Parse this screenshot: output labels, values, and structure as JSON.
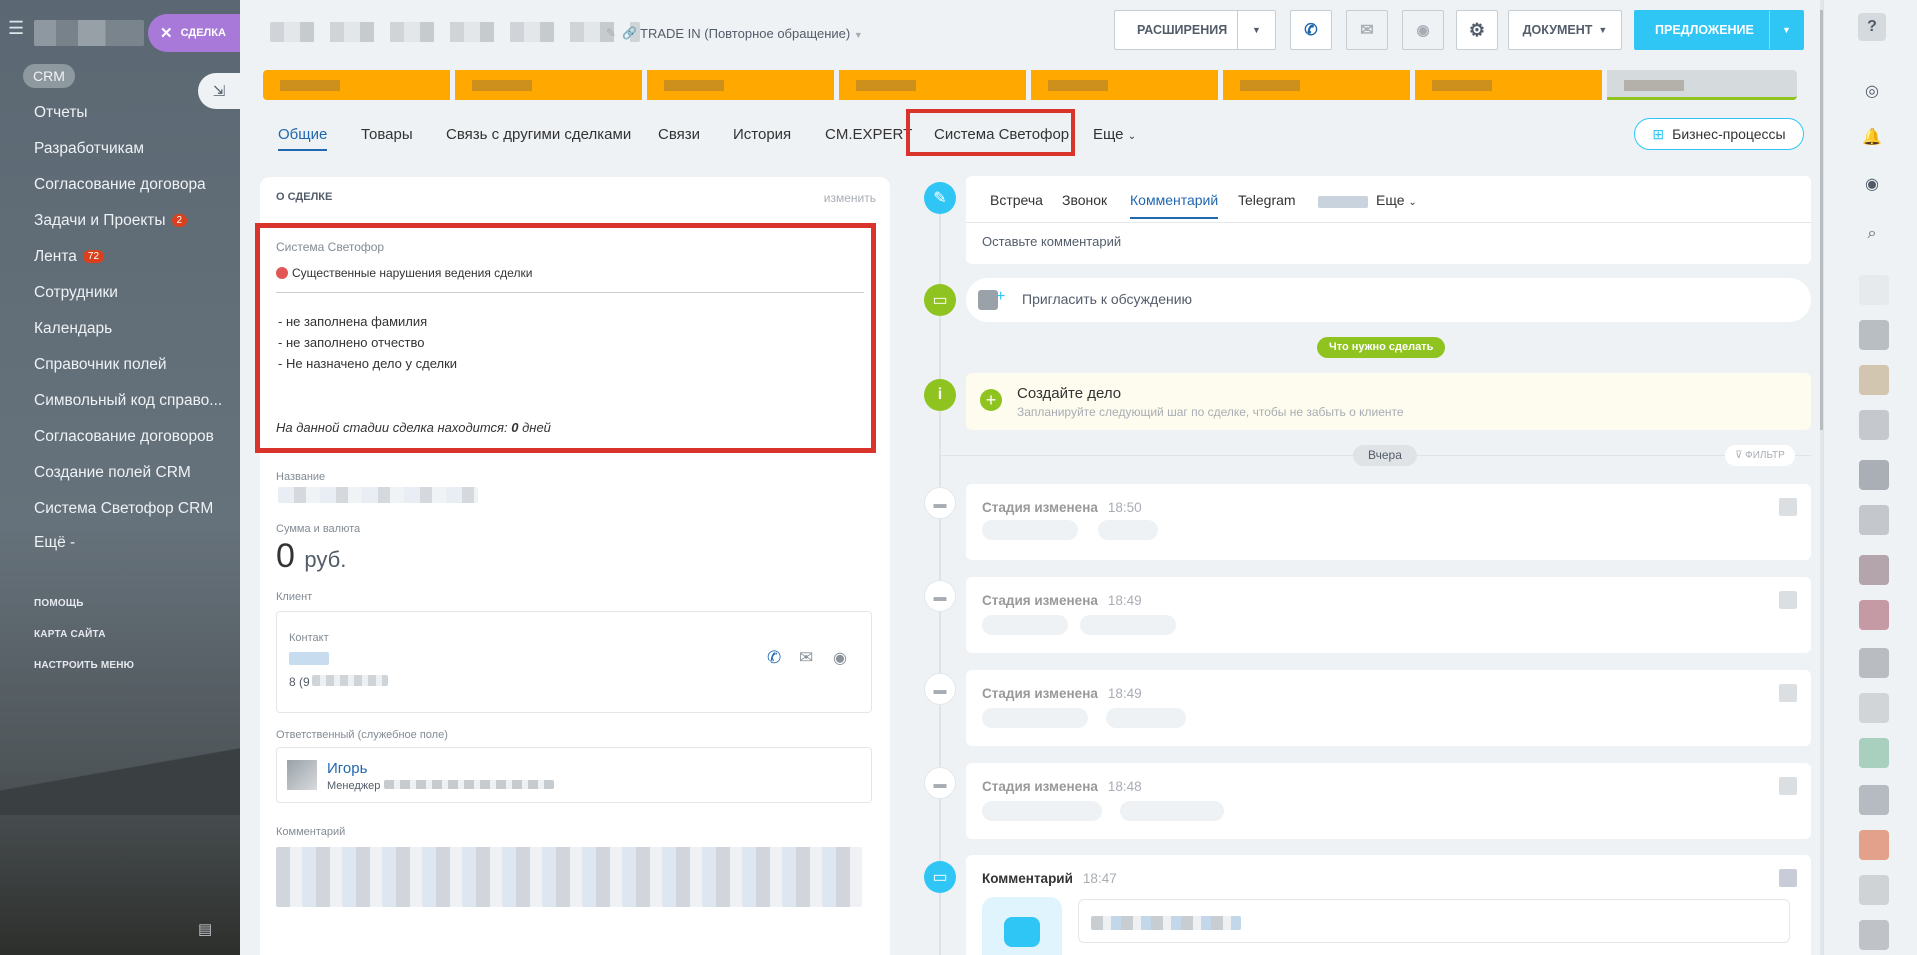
{
  "sidebar": {
    "crm_label": "CRM",
    "items": [
      {
        "label": "Отчеты"
      },
      {
        "label": "Разработчикам"
      },
      {
        "label": "Согласование договора"
      },
      {
        "label": "Задачи и Проекты",
        "badge": "2"
      },
      {
        "label": "Лента",
        "badge": "72"
      },
      {
        "label": "Сотрудники"
      },
      {
        "label": "Календарь"
      },
      {
        "label": "Справочник полей"
      },
      {
        "label": "Символьный код справо..."
      },
      {
        "label": "Согласование договоров"
      },
      {
        "label": "Создание полей CRM"
      },
      {
        "label": "Система Светофор CRM"
      },
      {
        "label": "Ещё -"
      }
    ],
    "footer": {
      "help": "ПОМОЩЬ",
      "sitemap": "КАРТА САЙТА",
      "configure": "НАСТРОИТЬ МЕНЮ"
    }
  },
  "deal_tag": {
    "label": "СДЕЛКА"
  },
  "header": {
    "title_suffix": "TRADE IN (Повторное обращение)",
    "extensions_label": "РАСШИРЕНИЯ",
    "document_label": "ДОКУМЕНТ",
    "offer_label": "ПРЕДЛОЖЕНИЕ"
  },
  "tabs": [
    {
      "label": "Общие",
      "active": true
    },
    {
      "label": "Товары"
    },
    {
      "label": "Связь с другими сделками"
    },
    {
      "label": "Связи"
    },
    {
      "label": "История"
    },
    {
      "label": "CM.EXPERT"
    },
    {
      "label": "Система Светофор",
      "highlighted": true
    },
    {
      "label": "Еще"
    }
  ],
  "business_processes_label": "Бизнес-процессы",
  "about": {
    "section_title": "О СДЕЛКЕ",
    "edit_link": "изменить",
    "svetofor": {
      "label": "Система Светофор",
      "status": "Существенные нарушения ведения сделки",
      "status_color": "#e25656",
      "issues": [
        "- не заполнена фамилия",
        "- не заполнено отчество",
        "- Не назначено дело у сделки"
      ],
      "stage_text": "На данной стадии сделка находится:",
      "stage_days": "0",
      "stage_unit": "дней"
    },
    "name_label": "Название",
    "amount_label": "Сумма и валюта",
    "amount_value": "0",
    "amount_currency": "руб.",
    "client_label": "Клиент",
    "contact_label": "Контакт",
    "contact_phone": "8 (9",
    "responsible_label": "Ответственный (служебное поле)",
    "responsible_name": "Игорь",
    "responsible_role": "Менеджер",
    "comment_label": "Комментарий"
  },
  "timeline": {
    "composer_tabs": [
      {
        "label": "Встреча"
      },
      {
        "label": "Звонок"
      },
      {
        "label": "Комментарий",
        "active": true
      },
      {
        "label": "Telegram"
      },
      {
        "label": "Еще"
      }
    ],
    "comment_placeholder": "Оставьте комментарий",
    "invite_label": "Пригласить к обсуждению",
    "todo_badge": "Что нужно сделать",
    "create_task_title": "Создайте дело",
    "create_task_hint": "Запланируйте следующий шаг по сделке, чтобы не забыть о клиенте",
    "yesterday_label": "Вчера",
    "filter_label": "ФИЛЬТР",
    "events": [
      {
        "title": "Стадия изменена",
        "time": "18:50"
      },
      {
        "title": "Стадия изменена",
        "time": "18:49"
      },
      {
        "title": "Стадия изменена",
        "time": "18:49"
      },
      {
        "title": "Стадия изменена",
        "time": "18:48"
      },
      {
        "title": "Комментарий",
        "time": "18:47"
      }
    ]
  },
  "colors": {
    "accent": "#2fc6f6",
    "stage": "#ffa900",
    "highlight_box": "#d9342b",
    "link": "#2067b0",
    "green": "#8fc31f"
  }
}
